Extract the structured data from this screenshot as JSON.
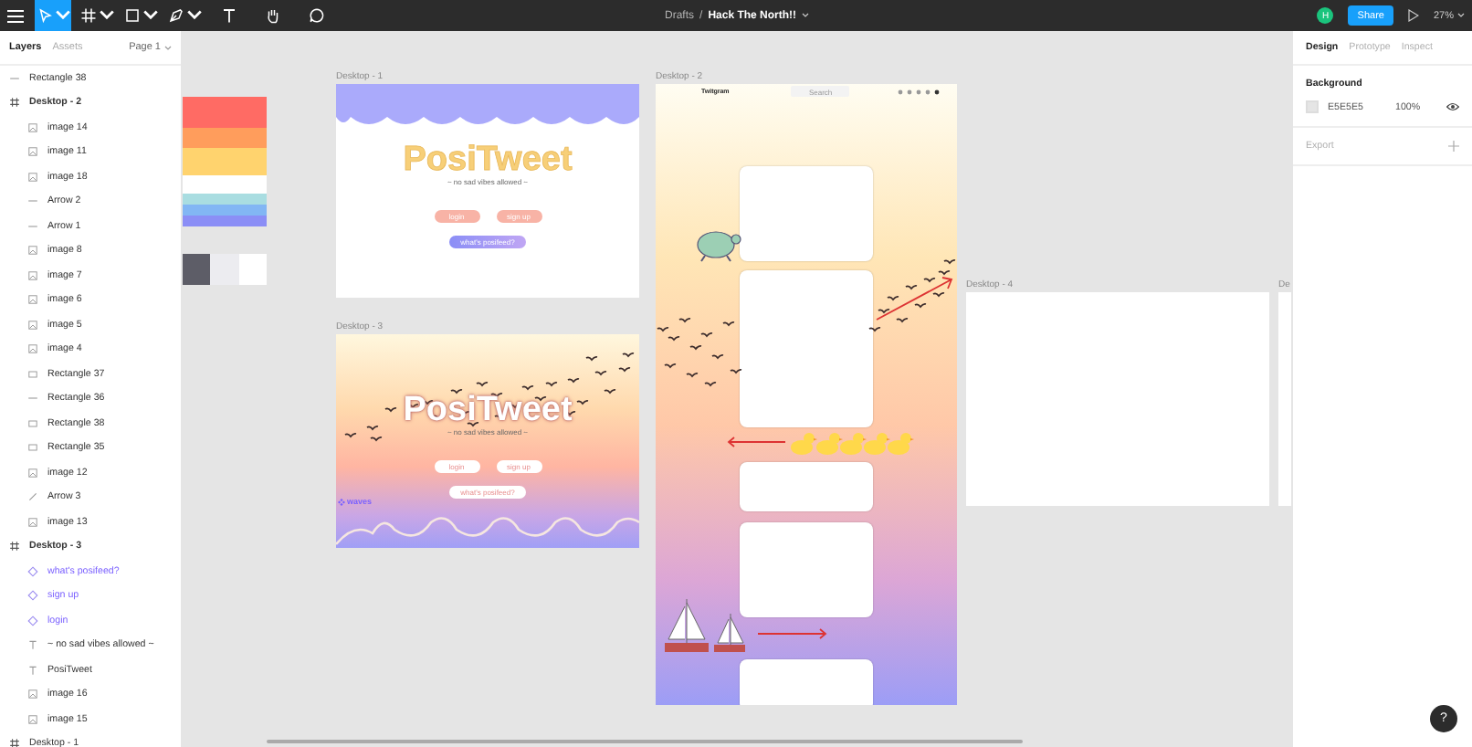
{
  "toolbar": {
    "tools": [
      {
        "kind": "move",
        "selected": true
      },
      {
        "kind": "frame",
        "selected": false
      },
      {
        "kind": "shape",
        "selected": false
      },
      {
        "kind": "pen",
        "selected": false
      },
      {
        "kind": "text",
        "selected": false
      },
      {
        "kind": "hand",
        "selected": false
      },
      {
        "kind": "comment",
        "selected": false
      }
    ],
    "breadcrumb": {
      "folder": "Drafts",
      "separator": "/",
      "file": "Hack The North!!"
    },
    "avatar": "H",
    "share": "Share",
    "zoom": "27%"
  },
  "layers_panel": {
    "tabs": [
      {
        "label": "Layers",
        "selected": true
      },
      {
        "label": "Assets",
        "selected": false
      }
    ],
    "page": "Page 1",
    "layers": [
      {
        "name": "Rectangle 38",
        "kind": "line"
      },
      {
        "name": "Desktop - 2",
        "kind": "frame",
        "children": [
          {
            "name": "image 14",
            "kind": "image"
          },
          {
            "name": "image 11",
            "kind": "image"
          },
          {
            "name": "image 18",
            "kind": "image"
          },
          {
            "name": "Arrow 2",
            "kind": "line"
          },
          {
            "name": "Arrow 1",
            "kind": "line"
          },
          {
            "name": "image 8",
            "kind": "image"
          },
          {
            "name": "image 7",
            "kind": "image"
          },
          {
            "name": "image 6",
            "kind": "image"
          },
          {
            "name": "image 5",
            "kind": "image"
          },
          {
            "name": "image 4",
            "kind": "image"
          },
          {
            "name": "Rectangle 37",
            "kind": "rect"
          },
          {
            "name": "Rectangle 36",
            "kind": "line"
          },
          {
            "name": "Rectangle 38",
            "kind": "rect"
          },
          {
            "name": "Rectangle 35",
            "kind": "rect"
          },
          {
            "name": "image 12",
            "kind": "image"
          },
          {
            "name": "Arrow 3",
            "kind": "arrow"
          },
          {
            "name": "image 13",
            "kind": "image"
          }
        ]
      },
      {
        "name": "Desktop - 3",
        "kind": "frame",
        "children": [
          {
            "name": "what's posifeed?",
            "kind": "component"
          },
          {
            "name": "sign up",
            "kind": "component"
          },
          {
            "name": "login",
            "kind": "component"
          },
          {
            "name": "~ no sad vibes allowed ~",
            "kind": "text"
          },
          {
            "name": "PosiTweet",
            "kind": "text"
          },
          {
            "name": "image 16",
            "kind": "image"
          },
          {
            "name": "image 15",
            "kind": "image"
          }
        ]
      },
      {
        "name": "Desktop - 1",
        "kind": "frame"
      }
    ]
  },
  "canvas": {
    "palette": [
      {
        "color": "#ff6b64"
      },
      {
        "color": "#ff9d5c"
      },
      {
        "color": "#ffd36e"
      },
      {
        "color": "#ffffff"
      },
      {
        "color": "#a9dde1"
      },
      {
        "color": "#82b6f4"
      },
      {
        "color": "#8b8ef6"
      }
    ],
    "neutrals": [
      {
        "color": "#5d5d67"
      },
      {
        "color": "#ececf0"
      },
      {
        "color": "#ffffff"
      }
    ],
    "frames": [
      {
        "label": "Desktop - 1",
        "kind": "landing-plain",
        "title": "PosiTweet",
        "tagline": "~ no sad vibes allowed ~",
        "buttons": [
          "login",
          "sign up"
        ],
        "cta": "what's posifeed?"
      },
      {
        "label": "Desktop - 3",
        "kind": "landing-sunset",
        "title": "PosiTweet",
        "tagline": "~ no sad vibes allowed ~",
        "buttons": [
          "login",
          "sign up"
        ],
        "cta": "what's posifeed?",
        "component_label": "waves"
      },
      {
        "label": "Desktop - 2",
        "kind": "feed",
        "logo": "Twitgram",
        "search": "Search"
      },
      {
        "label": "Desktop - 4",
        "kind": "blank"
      },
      {
        "label": "De",
        "kind": "partial"
      }
    ]
  },
  "design_panel": {
    "tabs": [
      {
        "label": "Design",
        "selected": true
      },
      {
        "label": "Prototype",
        "selected": false
      },
      {
        "label": "Inspect",
        "selected": false
      }
    ],
    "background": {
      "heading": "Background",
      "hex": "E5E5E5",
      "opacity": "100%",
      "color": "#e5e5e5"
    },
    "export": "Export"
  },
  "help": "?"
}
